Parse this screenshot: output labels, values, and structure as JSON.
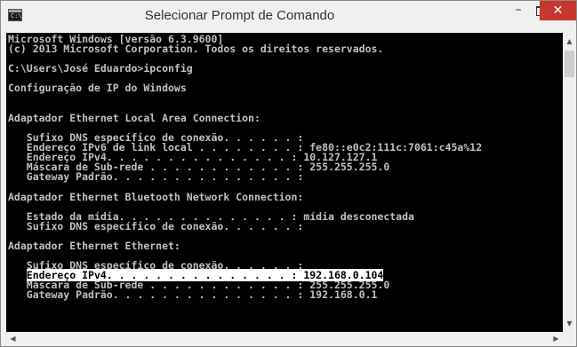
{
  "window": {
    "title": "Selecionar Prompt de Comando",
    "icon_label": "C:\\",
    "minimize_glyph": "–",
    "close_glyph": "✕"
  },
  "console": {
    "lines_before": [
      "Microsoft Windows [versão 6.3.9600]",
      "(c) 2013 Microsoft Corporation. Todos os direitos reservados.",
      "",
      "C:\\Users\\José Eduardo>ipconfig",
      "",
      "Configuração de IP do Windows",
      "",
      "",
      "Adaptador Ethernet Local Area Connection:",
      "",
      "   Sufixo DNS específico de conexão. . . . . . :",
      "   Endereço IPv6 de link local . . . . . . . . : fe80::e0c2:111c:7061:c45a%12",
      "   Endereço IPv4. . . . . . . . . . . . . . . : 10.127.127.1",
      "   Máscara de Sub-rede . . . . . . . . . . . . : 255.255.255.0",
      "   Gateway Padrão. . . . . . . . . . . . . . . :",
      "",
      "Adaptador Ethernet Bluetooth Network Connection:",
      "",
      "   Estado da mídia. . . . . . . . . . . . . . : mídia desconectada",
      "   Sufixo DNS específico de conexão. . . . . . :",
      "",
      "Adaptador Ethernet Ethernet:",
      "",
      "   Sufixo DNS específico de conexão. . . . . . :"
    ],
    "selection_indent": "   ",
    "selected_line": "Endereço IPv4. . . . . . . . . . . . . . . : 192.168.0.104",
    "lines_after": [
      "   Máscara de Sub-rede . . . . . . . . . . . . : 255.255.255.0",
      "   Gateway Padrão. . . . . . . . . . . . . . . : 192.168.0.1"
    ]
  },
  "scrollbars": {
    "up_glyph": "▲",
    "down_glyph": "▼",
    "left_glyph": "◀",
    "right_glyph": "▶"
  }
}
